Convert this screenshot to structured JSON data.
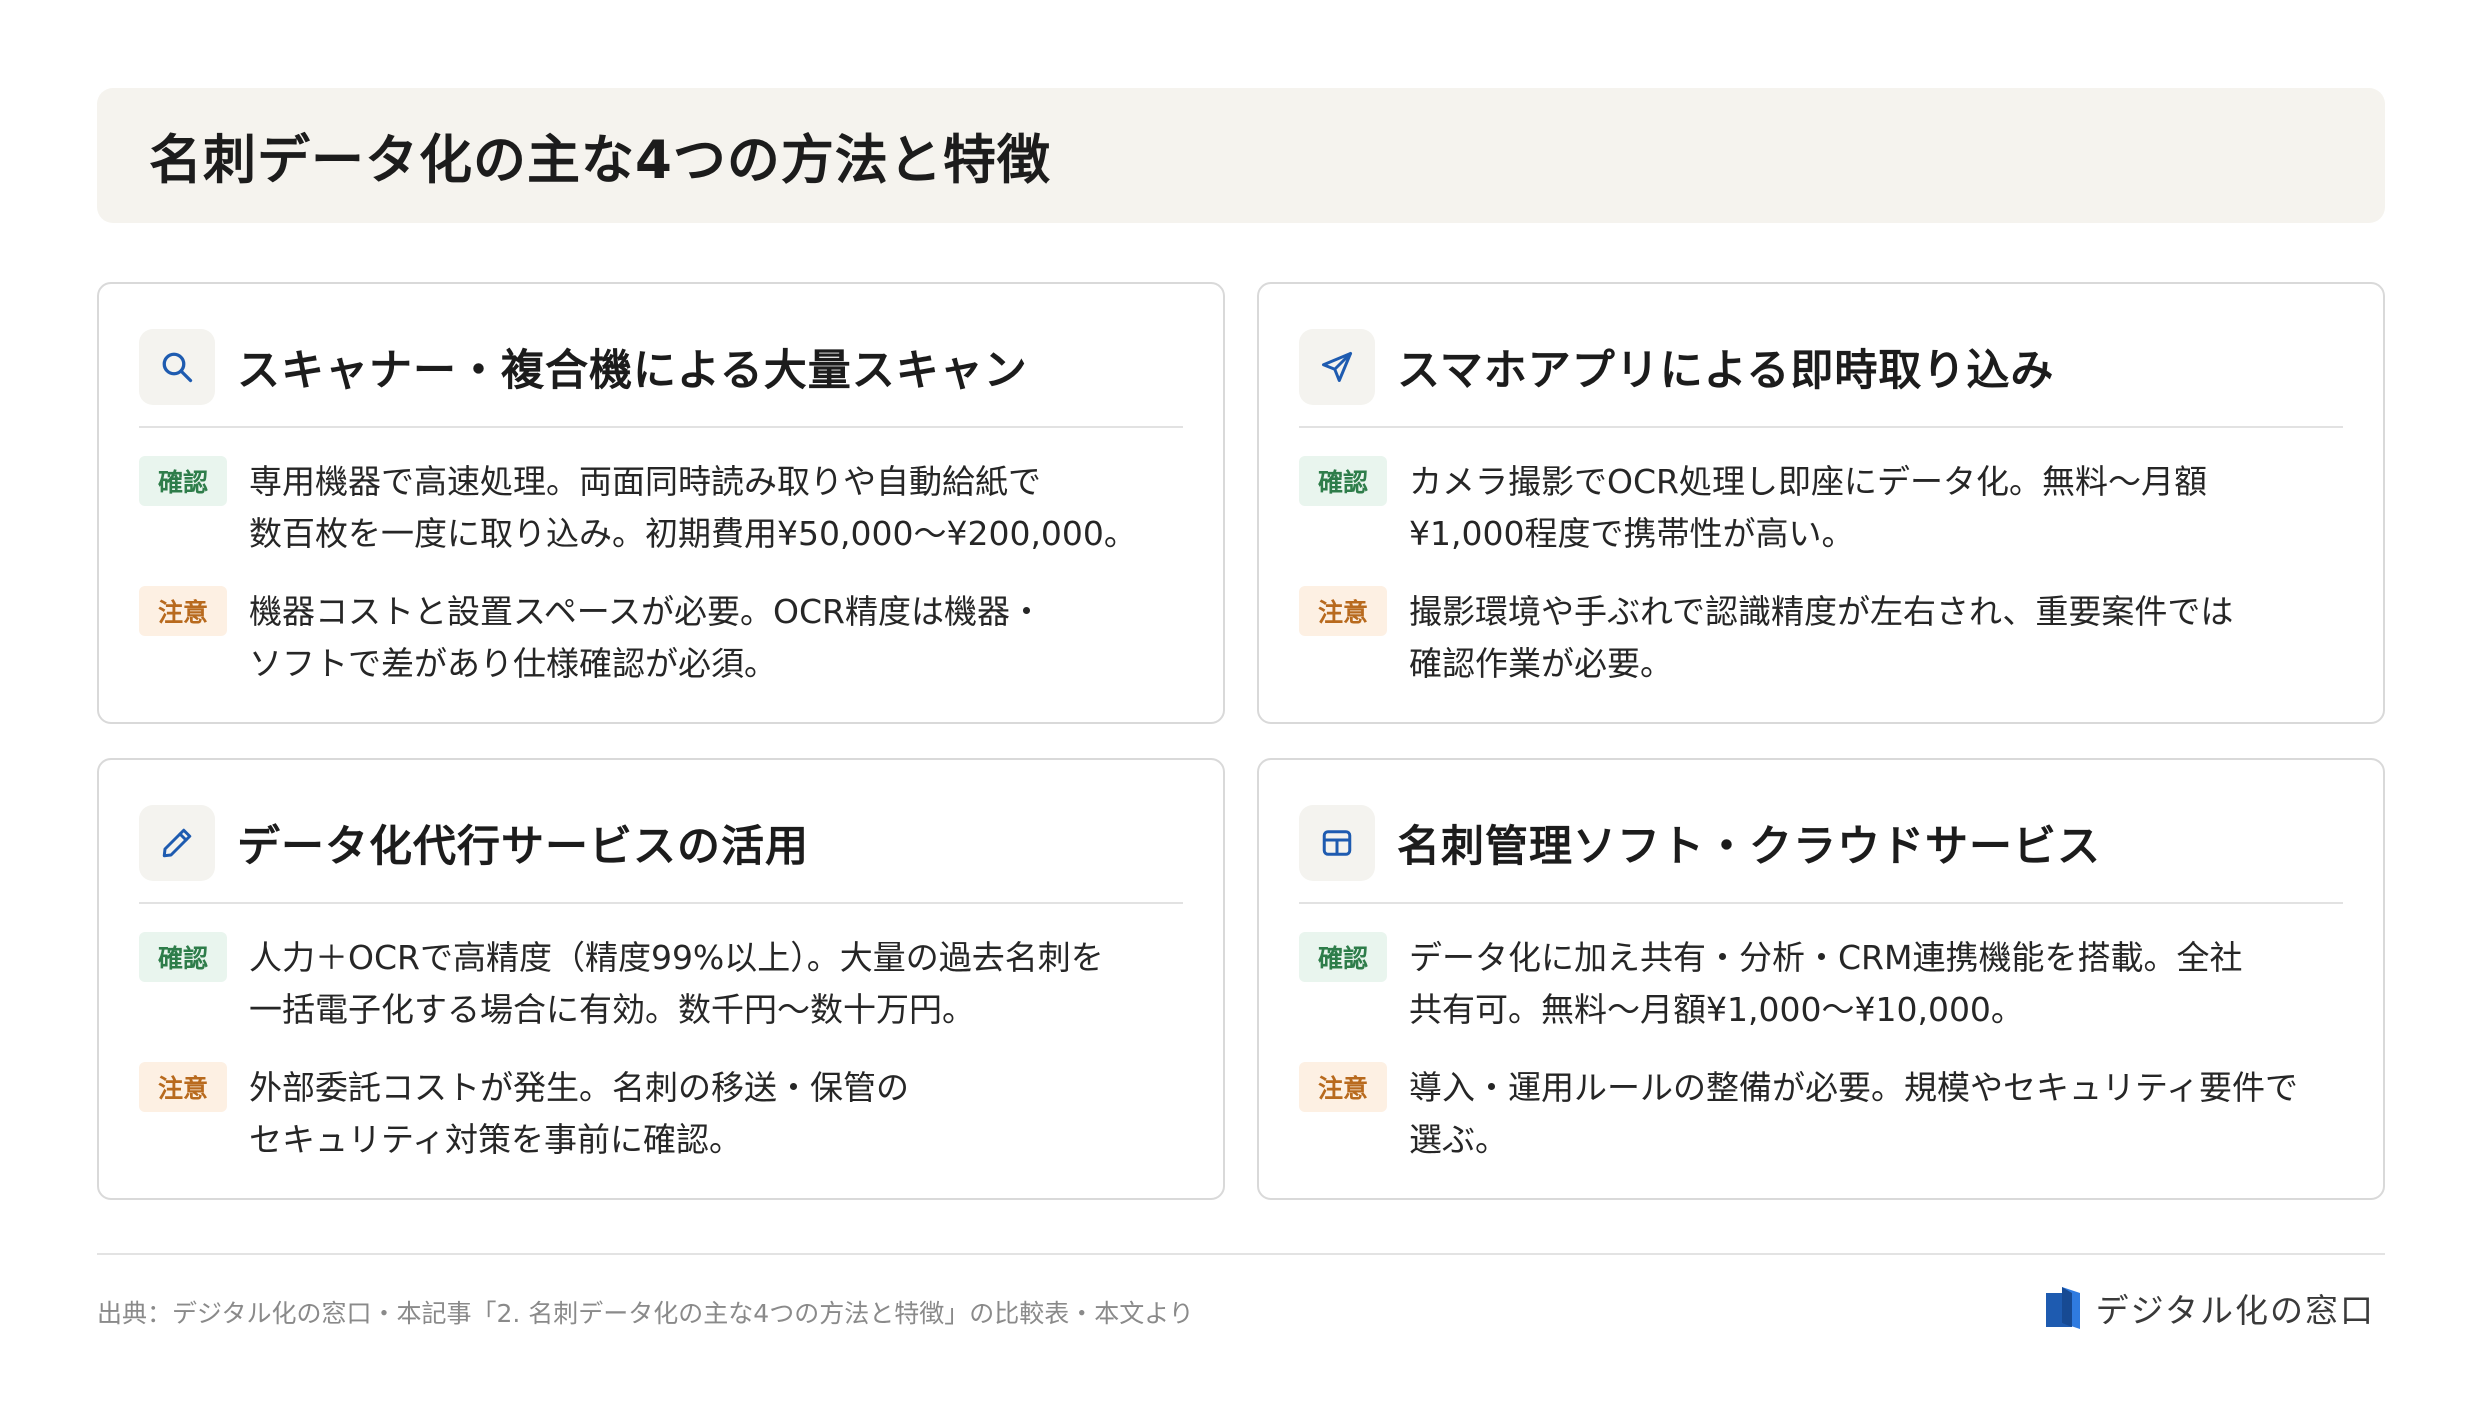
{
  "title": "名刺データ化の主な4つの方法と特徴",
  "cards": [
    {
      "icon": "search-icon",
      "title": "スキャナー・複合機による大量スキャン",
      "confirm_label": "確認",
      "confirm_text": "専用機器で高速処理。両面同時読み取りや自動給紙で\n数百枚を一度に取り込み。初期費用¥50,000〜¥200,000。",
      "caution_label": "注意",
      "caution_text": "機器コストと設置スペースが必要。OCR精度は機器・\nソフトで差があり仕様確認が必須。"
    },
    {
      "icon": "send-icon",
      "title": "スマホアプリによる即時取り込み",
      "confirm_label": "確認",
      "confirm_text": "カメラ撮影でOCR処理し即座にデータ化。無料〜月額\n¥1,000程度で携帯性が高い。",
      "caution_label": "注意",
      "caution_text": "撮影環境や手ぶれで認識精度が左右され、重要案件では\n確認作業が必要。"
    },
    {
      "icon": "pencil-icon",
      "title": "データ化代行サービスの活用",
      "confirm_label": "確認",
      "confirm_text": "人力＋OCRで高精度（精度99%以上）。大量の過去名刺を\n一括電子化する場合に有効。数千円〜数十万円。",
      "caution_label": "注意",
      "caution_text": "外部委託コストが発生。名刺の移送・保管の\nセキュリティ対策を事前に確認。"
    },
    {
      "icon": "table-icon",
      "title": "名刺管理ソフト・クラウドサービス",
      "confirm_label": "確認",
      "confirm_text": "データ化に加え共有・分析・CRM連携機能を搭載。全社\n共有可。無料〜月額¥1,000〜¥10,000。",
      "caution_label": "注意",
      "caution_text": "導入・運用ルールの整備が必要。規模やセキュリティ要件で\n選ぶ。"
    }
  ],
  "footer": {
    "source": "出典：デジタル化の窓口・本記事「2. 名刺データ化の主な4つの方法と特徴」の比較表・本文より",
    "logo_text": "デジタル化の窓口"
  },
  "colors": {
    "accent": "#1e5bb0",
    "confirm_badge_bg": "#e9f5ee",
    "confirm_badge_text": "#2e7d4a",
    "caution_badge_bg": "#fdf0e3",
    "caution_badge_text": "#b86a1e",
    "title_bar_bg": "#f5f3ee"
  }
}
